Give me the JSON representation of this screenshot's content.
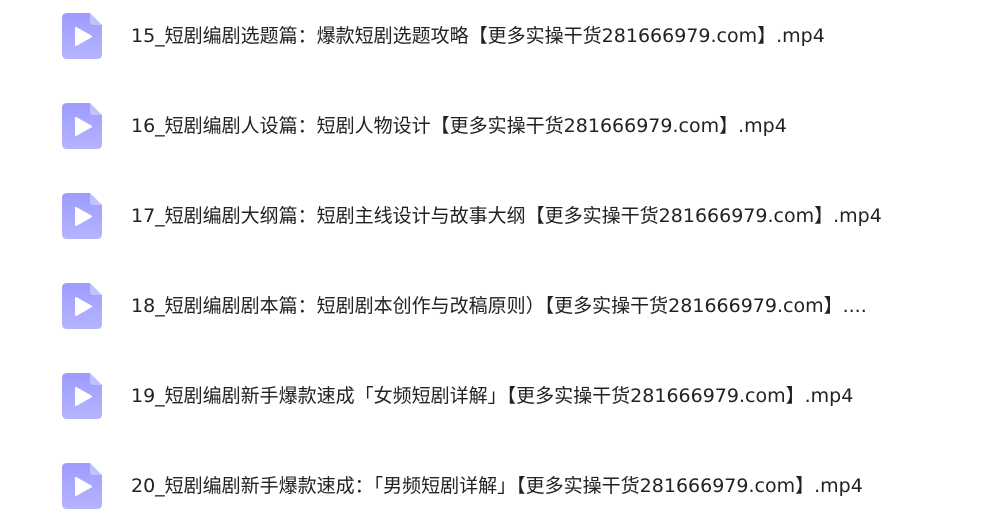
{
  "theme": {
    "icon_gradient_top": "#9d9cff",
    "icon_gradient_bottom": "#b5b4ff",
    "icon_glyph": "#ffffff",
    "text_color": "#222222"
  },
  "files": [
    {
      "icon": "video-file-play-icon",
      "name": "15_短剧编剧选题篇：爆款短剧选题攻略【更多实操干货281666979.com】.mp4"
    },
    {
      "icon": "video-file-play-icon",
      "name": "16_短剧编剧人设篇：短剧人物设计【更多实操干货281666979.com】.mp4"
    },
    {
      "icon": "video-file-play-icon",
      "name": "17_短剧编剧大纲篇：短剧主线设计与故事大纲【更多实操干货281666979.com】.mp4"
    },
    {
      "icon": "video-file-play-icon",
      "name": "18_短剧编剧剧本篇：短剧剧本创作与改稿原则）【更多实操干货281666979.com】...."
    },
    {
      "icon": "video-file-play-icon",
      "name": "19_短剧编剧新手爆款速成「女频短剧详解」【更多实操干货281666979.com】.mp4"
    },
    {
      "icon": "video-file-play-icon",
      "name": "20_短剧编剧新手爆款速成：「男频短剧详解」【更多实操干货281666979.com】.mp4"
    }
  ]
}
